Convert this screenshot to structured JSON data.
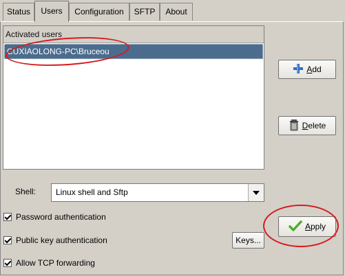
{
  "tabs": [
    {
      "label": "Status",
      "active": false
    },
    {
      "label": "Users",
      "active": true
    },
    {
      "label": "Configuration",
      "active": false
    },
    {
      "label": "SFTP",
      "active": false
    },
    {
      "label": "About",
      "active": false
    }
  ],
  "users_list": {
    "header": "Activated users",
    "rows": [
      "CUXIAOLONG-PC\\Bruceou"
    ]
  },
  "buttons": {
    "add": {
      "mnemonic": "A",
      "rest": "dd",
      "icon": "plus-icon"
    },
    "delete": {
      "mnemonic": "D",
      "rest": "elete",
      "icon": "trash-can-icon"
    },
    "apply": {
      "mnemonic": "A",
      "rest": "pply",
      "icon": "checkmark-icon"
    },
    "keys": {
      "label": "Keys..."
    }
  },
  "shell": {
    "label": "Shell:",
    "selected": "Linux shell and Sftp"
  },
  "options": [
    {
      "label": "Password authentication",
      "checked": true
    },
    {
      "label": "Public key authentication",
      "checked": true
    },
    {
      "label": "Allow TCP forwarding",
      "checked": true
    }
  ],
  "colors": {
    "selection": "#4b6c8c",
    "annotation": "#d7191c",
    "plus_icon": "#2f6fc0",
    "check_icon": "#4caf2a"
  }
}
